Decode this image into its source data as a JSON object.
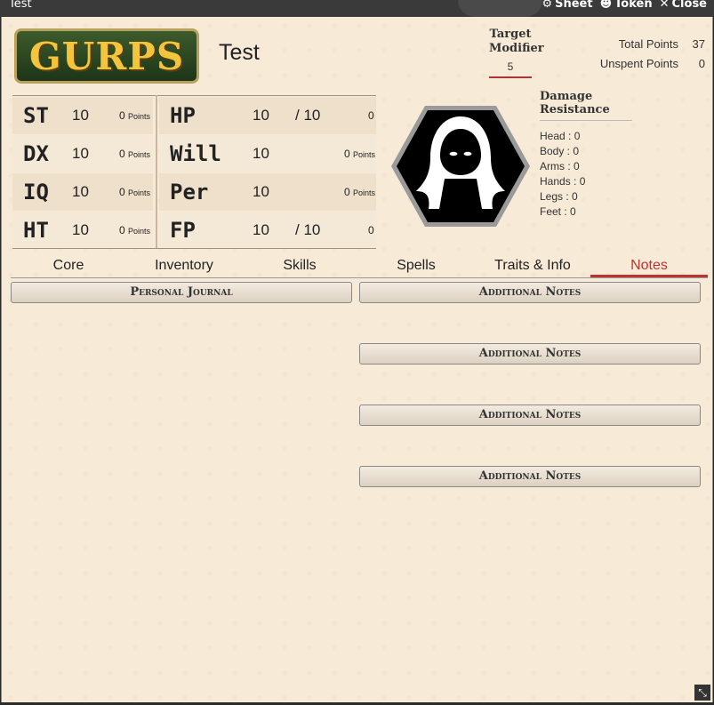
{
  "window": {
    "title": "Test",
    "sheet_label": "Sheet",
    "token_label": "Token",
    "close_label": "Close"
  },
  "header": {
    "logo_text": "GURPS",
    "character_name": "Test",
    "target_modifier": {
      "label_line1": "Target",
      "label_line2": "Modifier",
      "value": "5"
    },
    "total_points": {
      "label": "Total Points",
      "value": "37"
    },
    "unspent_points": {
      "label": "Unspent Points",
      "value": "0"
    }
  },
  "attributes": [
    {
      "name": "ST",
      "value": "10",
      "points": "0",
      "points_label": "Points"
    },
    {
      "name": "DX",
      "value": "10",
      "points": "0",
      "points_label": "Points"
    },
    {
      "name": "IQ",
      "value": "10",
      "points": "0",
      "points_label": "Points"
    },
    {
      "name": "HT",
      "value": "10",
      "points": "0",
      "points_label": "Points"
    }
  ],
  "secondary": [
    {
      "name": "HP",
      "value": "10",
      "max": "/ 10",
      "points": "0"
    },
    {
      "name": "Will",
      "value": "10",
      "points": "0",
      "points_label": "Points"
    },
    {
      "name": "Per",
      "value": "10",
      "points": "0",
      "points_label": "Points"
    },
    {
      "name": "FP",
      "value": "10",
      "max": "/ 10",
      "points": "0"
    }
  ],
  "damage_resistance": {
    "title": "Damage Resistance",
    "locations": [
      "Head : 0",
      "Body : 0",
      "Arms : 0",
      "Hands : 0",
      "Legs : 0",
      "Feet : 0"
    ]
  },
  "tabs": [
    "Core",
    "Inventory",
    "Skills",
    "Spells",
    "Traits & Info",
    "Notes"
  ],
  "active_tab": "Notes",
  "notes": {
    "journal_label": "Personal Journal",
    "additional_label": "Additional Notes"
  },
  "colors": {
    "accent": "#b33333",
    "background": "#f7ead6",
    "logo_green": "#2f4a24",
    "logo_gold": "#f2c53d"
  },
  "icons": [
    "gear-icon",
    "user-circle-icon",
    "close-icon",
    "resize-icon"
  ]
}
